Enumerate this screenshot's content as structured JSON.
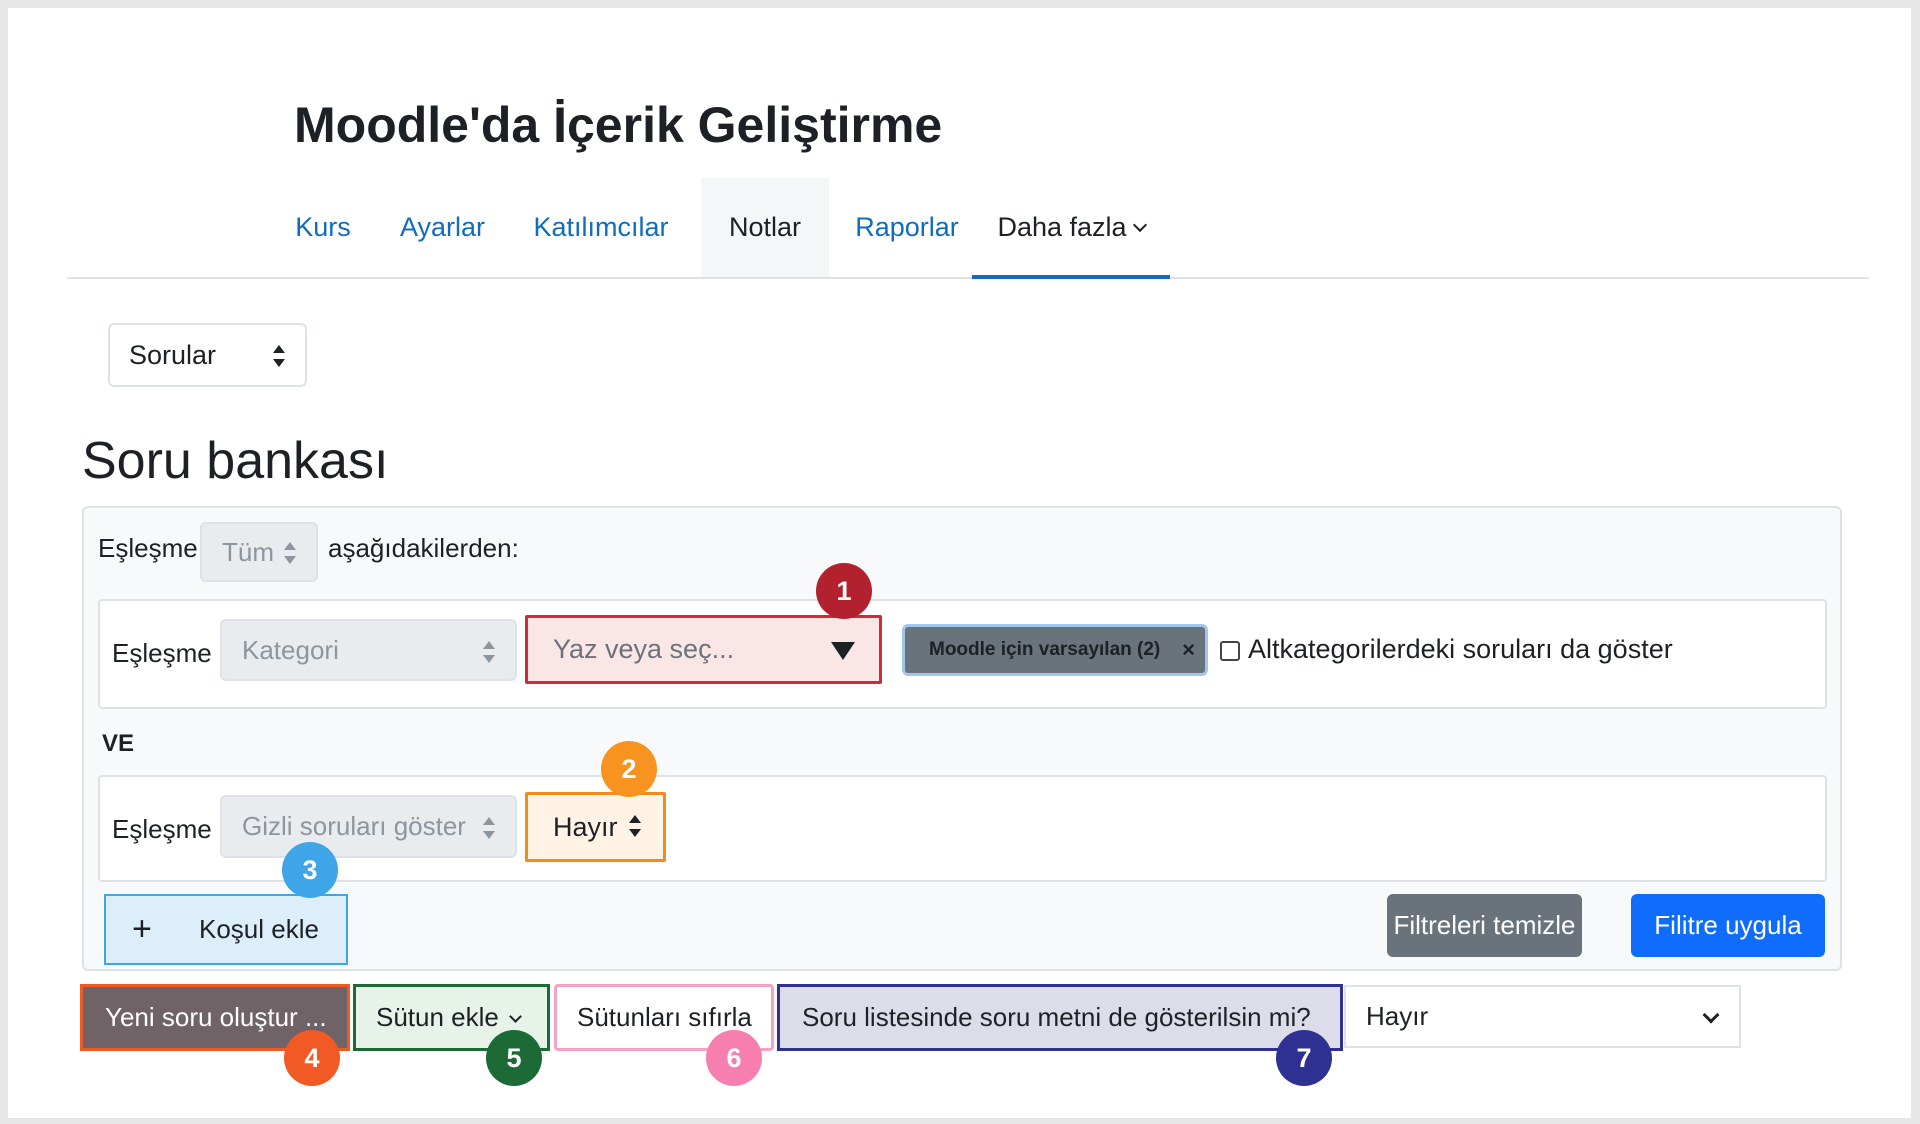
{
  "course": {
    "title": "Moodle'da İçerik Geliştirme"
  },
  "nav": {
    "items": [
      {
        "label": "Kurs"
      },
      {
        "label": "Ayarlar"
      },
      {
        "label": "Katılımcılar"
      },
      {
        "label": "Notlar"
      },
      {
        "label": "Raporlar"
      },
      {
        "label": "Daha fazla"
      }
    ],
    "active": "Notlar"
  },
  "page_select": {
    "value": "Sorular"
  },
  "page_title": "Soru bankası",
  "filters": {
    "match_label": "Eşleşme",
    "match_value": "Tüm",
    "match_suffix": "aşağıdakilerden:",
    "row1": {
      "label": "Eşleşme",
      "type": "Kategori",
      "search_placeholder": "Yaz veya seç...",
      "tag": "Moodle için varsayılan (2)",
      "tag_remove": "×",
      "subcategory_checkbox": "Altkategorilerdeki soruları da göster"
    },
    "joiner": "VE",
    "row2": {
      "label": "Eşleşme",
      "type": "Gizli soruları göster",
      "value": "Hayır"
    },
    "add_condition": "Koşul ekle",
    "clear": "Filtreleri temizle",
    "apply": "Filitre uygula"
  },
  "toolbar": {
    "new_question": "Yeni soru oluştur ...",
    "add_column": "Sütun ekle",
    "reset_columns": "Sütunları sıfırla",
    "show_text_label": "Soru listesinde soru metni de gösterilsin mi?",
    "show_text_value": "Hayır"
  },
  "badges": [
    "1",
    "2",
    "3",
    "4",
    "5",
    "6",
    "7"
  ],
  "colors": {
    "badge1": "#b3202e",
    "badge2": "#f7931e",
    "badge3": "#3ea6e8",
    "badge4": "#f15a24",
    "badge5": "#1c6b36",
    "badge6": "#f77fb0",
    "badge7": "#2e3192",
    "link": "#0f6cbf",
    "primary": "#0f6cfd",
    "secondary": "#6a737b"
  }
}
